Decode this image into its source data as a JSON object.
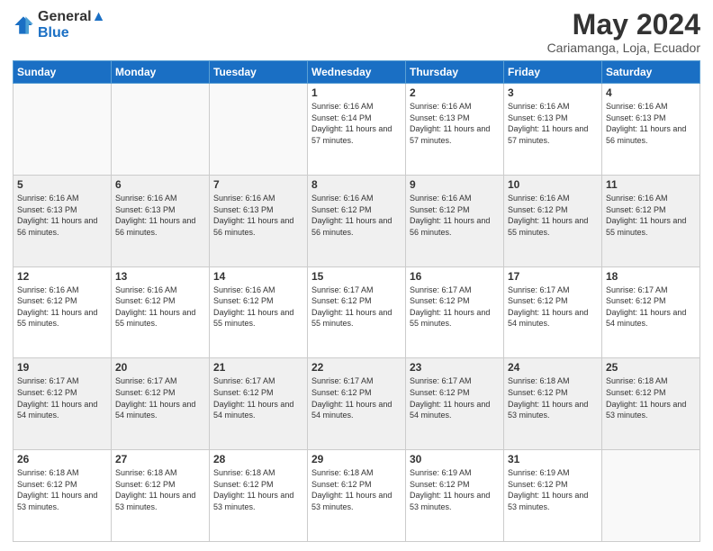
{
  "header": {
    "logo_line1": "General",
    "logo_line2": "Blue",
    "month_title": "May 2024",
    "location": "Cariamanga, Loja, Ecuador"
  },
  "weekdays": [
    "Sunday",
    "Monday",
    "Tuesday",
    "Wednesday",
    "Thursday",
    "Friday",
    "Saturday"
  ],
  "weeks": [
    [
      {
        "day": "",
        "info": ""
      },
      {
        "day": "",
        "info": ""
      },
      {
        "day": "",
        "info": ""
      },
      {
        "day": "1",
        "info": "Sunrise: 6:16 AM\nSunset: 6:14 PM\nDaylight: 11 hours and 57 minutes."
      },
      {
        "day": "2",
        "info": "Sunrise: 6:16 AM\nSunset: 6:13 PM\nDaylight: 11 hours and 57 minutes."
      },
      {
        "day": "3",
        "info": "Sunrise: 6:16 AM\nSunset: 6:13 PM\nDaylight: 11 hours and 57 minutes."
      },
      {
        "day": "4",
        "info": "Sunrise: 6:16 AM\nSunset: 6:13 PM\nDaylight: 11 hours and 56 minutes."
      }
    ],
    [
      {
        "day": "5",
        "info": "Sunrise: 6:16 AM\nSunset: 6:13 PM\nDaylight: 11 hours and 56 minutes."
      },
      {
        "day": "6",
        "info": "Sunrise: 6:16 AM\nSunset: 6:13 PM\nDaylight: 11 hours and 56 minutes."
      },
      {
        "day": "7",
        "info": "Sunrise: 6:16 AM\nSunset: 6:13 PM\nDaylight: 11 hours and 56 minutes."
      },
      {
        "day": "8",
        "info": "Sunrise: 6:16 AM\nSunset: 6:12 PM\nDaylight: 11 hours and 56 minutes."
      },
      {
        "day": "9",
        "info": "Sunrise: 6:16 AM\nSunset: 6:12 PM\nDaylight: 11 hours and 56 minutes."
      },
      {
        "day": "10",
        "info": "Sunrise: 6:16 AM\nSunset: 6:12 PM\nDaylight: 11 hours and 55 minutes."
      },
      {
        "day": "11",
        "info": "Sunrise: 6:16 AM\nSunset: 6:12 PM\nDaylight: 11 hours and 55 minutes."
      }
    ],
    [
      {
        "day": "12",
        "info": "Sunrise: 6:16 AM\nSunset: 6:12 PM\nDaylight: 11 hours and 55 minutes."
      },
      {
        "day": "13",
        "info": "Sunrise: 6:16 AM\nSunset: 6:12 PM\nDaylight: 11 hours and 55 minutes."
      },
      {
        "day": "14",
        "info": "Sunrise: 6:16 AM\nSunset: 6:12 PM\nDaylight: 11 hours and 55 minutes."
      },
      {
        "day": "15",
        "info": "Sunrise: 6:17 AM\nSunset: 6:12 PM\nDaylight: 11 hours and 55 minutes."
      },
      {
        "day": "16",
        "info": "Sunrise: 6:17 AM\nSunset: 6:12 PM\nDaylight: 11 hours and 55 minutes."
      },
      {
        "day": "17",
        "info": "Sunrise: 6:17 AM\nSunset: 6:12 PM\nDaylight: 11 hours and 54 minutes."
      },
      {
        "day": "18",
        "info": "Sunrise: 6:17 AM\nSunset: 6:12 PM\nDaylight: 11 hours and 54 minutes."
      }
    ],
    [
      {
        "day": "19",
        "info": "Sunrise: 6:17 AM\nSunset: 6:12 PM\nDaylight: 11 hours and 54 minutes."
      },
      {
        "day": "20",
        "info": "Sunrise: 6:17 AM\nSunset: 6:12 PM\nDaylight: 11 hours and 54 minutes."
      },
      {
        "day": "21",
        "info": "Sunrise: 6:17 AM\nSunset: 6:12 PM\nDaylight: 11 hours and 54 minutes."
      },
      {
        "day": "22",
        "info": "Sunrise: 6:17 AM\nSunset: 6:12 PM\nDaylight: 11 hours and 54 minutes."
      },
      {
        "day": "23",
        "info": "Sunrise: 6:17 AM\nSunset: 6:12 PM\nDaylight: 11 hours and 54 minutes."
      },
      {
        "day": "24",
        "info": "Sunrise: 6:18 AM\nSunset: 6:12 PM\nDaylight: 11 hours and 53 minutes."
      },
      {
        "day": "25",
        "info": "Sunrise: 6:18 AM\nSunset: 6:12 PM\nDaylight: 11 hours and 53 minutes."
      }
    ],
    [
      {
        "day": "26",
        "info": "Sunrise: 6:18 AM\nSunset: 6:12 PM\nDaylight: 11 hours and 53 minutes."
      },
      {
        "day": "27",
        "info": "Sunrise: 6:18 AM\nSunset: 6:12 PM\nDaylight: 11 hours and 53 minutes."
      },
      {
        "day": "28",
        "info": "Sunrise: 6:18 AM\nSunset: 6:12 PM\nDaylight: 11 hours and 53 minutes."
      },
      {
        "day": "29",
        "info": "Sunrise: 6:18 AM\nSunset: 6:12 PM\nDaylight: 11 hours and 53 minutes."
      },
      {
        "day": "30",
        "info": "Sunrise: 6:19 AM\nSunset: 6:12 PM\nDaylight: 11 hours and 53 minutes."
      },
      {
        "day": "31",
        "info": "Sunrise: 6:19 AM\nSunset: 6:12 PM\nDaylight: 11 hours and 53 minutes."
      },
      {
        "day": "",
        "info": ""
      }
    ]
  ]
}
